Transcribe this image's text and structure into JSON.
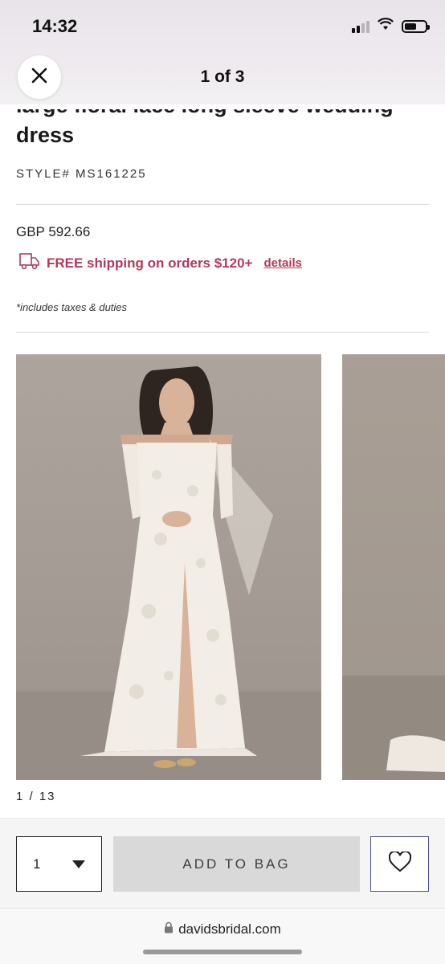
{
  "status_bar": {
    "time": "14:32"
  },
  "header": {
    "title": "1 of 3"
  },
  "product": {
    "title_partial": "large floral lace long sleeve wedding",
    "title_line2": "dress",
    "style_label": "STYLE# MS161225",
    "price": "GBP 592.66",
    "shipping_text": "FREE shipping on orders $120+",
    "shipping_link": "details",
    "taxes_note": "*includes taxes & duties"
  },
  "gallery": {
    "counter": "1 / 13"
  },
  "purchase_bar": {
    "quantity": "1",
    "add_to_bag": "ADD TO BAG"
  },
  "browser": {
    "url": "davidsbridal.com"
  },
  "colors": {
    "accent": "#b03a5b",
    "button_bg": "#d9d9d9",
    "wishlist_border": "#4a4f8a"
  },
  "icons": [
    "close-icon",
    "truck-icon",
    "chevron-down-icon",
    "heart-icon",
    "lock-icon",
    "wifi-icon",
    "battery-icon",
    "signal-icon"
  ]
}
